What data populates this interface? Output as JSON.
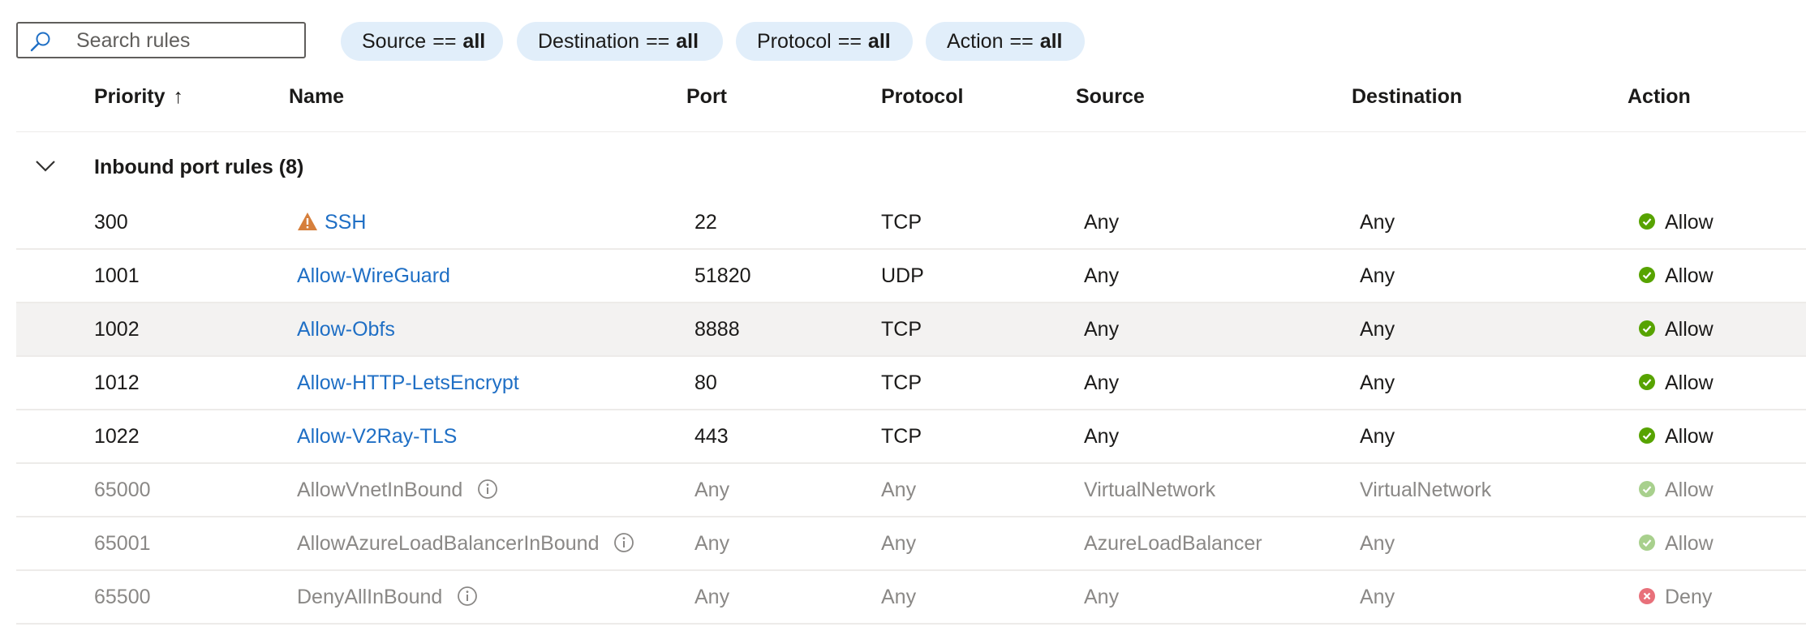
{
  "search": {
    "placeholder": "Search rules",
    "value": ""
  },
  "filters": [
    {
      "field": "Source",
      "op": "==",
      "value": "all"
    },
    {
      "field": "Destination",
      "op": "==",
      "value": "all"
    },
    {
      "field": "Protocol",
      "op": "==",
      "value": "all"
    },
    {
      "field": "Action",
      "op": "==",
      "value": "all"
    }
  ],
  "columns": {
    "priority": "Priority",
    "priority_sort": "↑",
    "name": "Name",
    "port": "Port",
    "protocol": "Protocol",
    "source": "Source",
    "destination": "Destination",
    "action": "Action"
  },
  "group": {
    "title": "Inbound port rules (8)",
    "expanded": true
  },
  "rows": [
    {
      "priority": "300",
      "name": "SSH",
      "warning": true,
      "port": "22",
      "protocol": "TCP",
      "source": "Any",
      "destination": "Any",
      "action": "Allow"
    },
    {
      "priority": "1001",
      "name": "Allow-WireGuard",
      "port": "51820",
      "protocol": "UDP",
      "source": "Any",
      "destination": "Any",
      "action": "Allow"
    },
    {
      "priority": "1002",
      "name": "Allow-Obfs",
      "port": "8888",
      "protocol": "TCP",
      "source": "Any",
      "destination": "Any",
      "action": "Allow",
      "selected": true
    },
    {
      "priority": "1012",
      "name": "Allow-HTTP-LetsEncrypt",
      "port": "80",
      "protocol": "TCP",
      "source": "Any",
      "destination": "Any",
      "action": "Allow"
    },
    {
      "priority": "1022",
      "name": "Allow-V2Ray-TLS",
      "port": "443",
      "protocol": "TCP",
      "source": "Any",
      "destination": "Any",
      "action": "Allow"
    },
    {
      "priority": "65000",
      "name": "AllowVnetInBound",
      "default_rule": true,
      "port": "Any",
      "protocol": "Any",
      "source": "VirtualNetwork",
      "destination": "VirtualNetwork",
      "action": "Allow"
    },
    {
      "priority": "65001",
      "name": "AllowAzureLoadBalancerInBound",
      "default_rule": true,
      "port": "Any",
      "protocol": "Any",
      "source": "AzureLoadBalancer",
      "destination": "Any",
      "action": "Allow"
    },
    {
      "priority": "65500",
      "name": "DenyAllInBound",
      "default_rule": true,
      "port": "Any",
      "protocol": "Any",
      "source": "Any",
      "destination": "Any",
      "action": "Deny"
    }
  ],
  "colors": {
    "link": "#1f6fc5",
    "allow": "#57a300",
    "allow_muted": "#a8d08d",
    "deny": "#e8707a",
    "warning": "#d67f3c",
    "pill_bg": "#e1eefa",
    "selected_row": "#f3f2f1"
  },
  "icons": {
    "search": "search-icon",
    "chevron": "chevron-down-icon",
    "warning": "warning-icon",
    "info": "info-icon",
    "allow": "check-circle-icon",
    "deny": "x-circle-icon"
  }
}
